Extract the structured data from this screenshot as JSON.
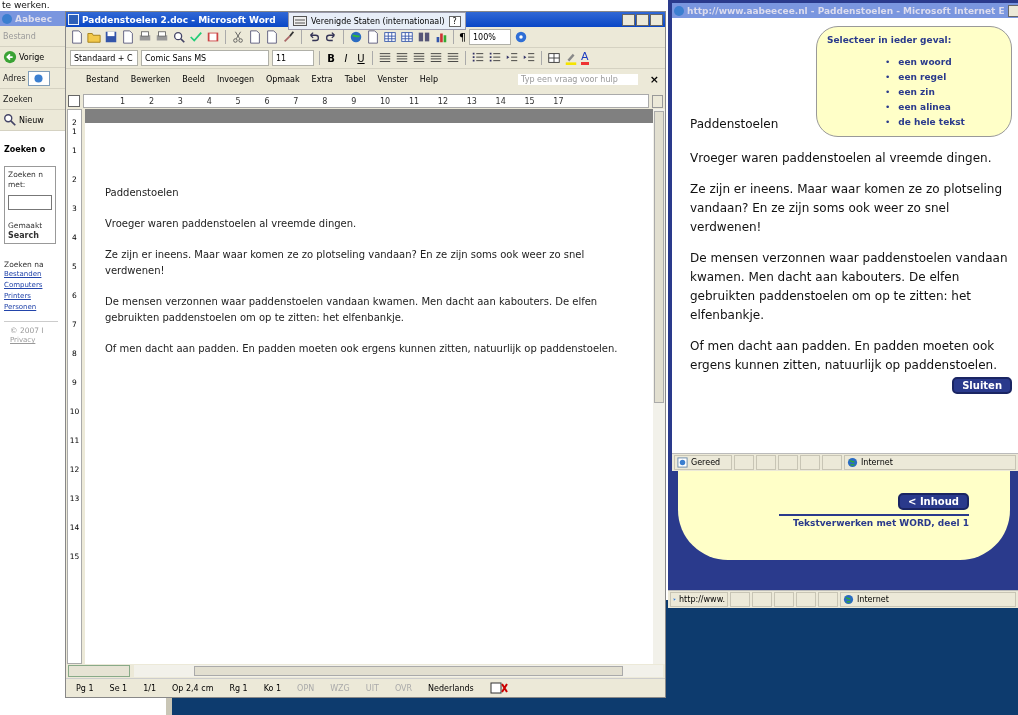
{
  "caption": "te werken.",
  "back_browser": {
    "title": "Aabeec",
    "menu": [
      "Bestand"
    ],
    "back_button": "Vorige",
    "address_label": "Adres",
    "search_bar_label": "Zoeken",
    "new_button": "Nieuw",
    "panel_title": "Zoeken o",
    "search_panel": {
      "label_lines": [
        "Zoeken n",
        "met:"
      ],
      "made_by": "Gemaakt",
      "engine": "Search"
    },
    "other_search_label": "Zoeken na",
    "links": [
      "Bestanden",
      "Computers",
      "Printers",
      "Personen"
    ],
    "copyright": "© 2007 I",
    "privacy_link": "Privacy"
  },
  "word": {
    "title": "Paddenstoelen 2.doc - Microsoft Word",
    "language_bar": {
      "language": "Verenigde Staten (internationaal)",
      "help": "?"
    },
    "zoom": "100%",
    "pilcrow": "¶",
    "style": "Standaard + C",
    "font": "Comic Sans MS",
    "size": "11",
    "format_buttons": [
      {
        "label": "B",
        "kind": "bold"
      },
      {
        "label": "I",
        "kind": "italic"
      },
      {
        "label": "U",
        "kind": "underline"
      }
    ],
    "font_color_label": "A",
    "menu": [
      "Bestand",
      "Bewerken",
      "Beeld",
      "Invoegen",
      "Opmaak",
      "Extra",
      "Tabel",
      "Venster",
      "Help"
    ],
    "help_placeholder": "Typ een vraag voor hulp",
    "close_document": "×",
    "ruler_numbers": [
      "1",
      "2",
      "3",
      "4",
      "5",
      "6",
      "7",
      "8",
      "9",
      "10",
      "11",
      "12",
      "13",
      "14",
      "15",
      "17"
    ],
    "vertical_ruler_numbers": [
      "2",
      "1",
      "1",
      "2",
      "3",
      "4",
      "5",
      "6",
      "7",
      "8",
      "9",
      "10",
      "11",
      "12",
      "13",
      "14",
      "15"
    ],
    "document": {
      "heading": "Paddenstoelen",
      "paragraphs": [
        "Vroeger waren paddenstoelen al vreemde dingen.",
        "Ze zijn er ineens. Maar waar komen ze zo plotseling vandaan? En ze zijn soms ook weer zo snel verdwenen!",
        "De mensen verzonnen waar paddenstoelen vandaan kwamen. Men dacht aan kabouters. De elfen gebruikten paddenstoelen om op te zitten: het elfenbankje.",
        "Of men dacht aan padden. En padden moeten ook ergens kunnen zitten, natuurlijk op paddenstoelen."
      ]
    },
    "status_bar": {
      "fields": [
        "Pg 1",
        "Se 1",
        "1/1",
        "Op 2,4 cm",
        "Rg 1",
        "Ko 1"
      ],
      "indicators": [
        {
          "label": "OPN",
          "on": false
        },
        {
          "label": "WZG",
          "on": false
        },
        {
          "label": "UIT",
          "on": false
        },
        {
          "label": "OVR",
          "on": false
        }
      ],
      "language": "Nederlands"
    }
  },
  "browser": {
    "title": "http://www.aabeecee.nl - Paddenstoelen - Microsoft Internet E",
    "tip_box": {
      "heading": "Selecteer in ieder geval:",
      "bullet": "•",
      "items": [
        "een woord",
        "een regel",
        "een zin",
        "een alinea",
        "de hele tekst"
      ]
    },
    "heading": "Paddenstoelen",
    "paragraphs": [
      "Vroeger waren paddenstoelen al vreemde dingen.",
      "Ze zijn er ineens. Maar waar komen ze zo plotseling vandaan? En ze zijn soms ook weer zo snel verdwenen!",
      "De mensen verzonnen waar paddenstoelen vandaan kwamen. Men dacht aan kabouters. De elfen gebruikten paddenstoelen om op te zitten: het elfenbankje.",
      "Of men dacht aan padden. En padden moeten ook ergens kunnen zitten, natuurlijk op paddenstoelen."
    ],
    "close_button": "Sluiten",
    "status_bar": {
      "text": "Gereed",
      "zone": "Internet"
    }
  },
  "back_page": {
    "contents_button": "< Inhoud",
    "footer": "Tekstverwerken met WORD, deel 1",
    "status_bar": {
      "text": "http://www.",
      "zone": "Internet"
    }
  }
}
